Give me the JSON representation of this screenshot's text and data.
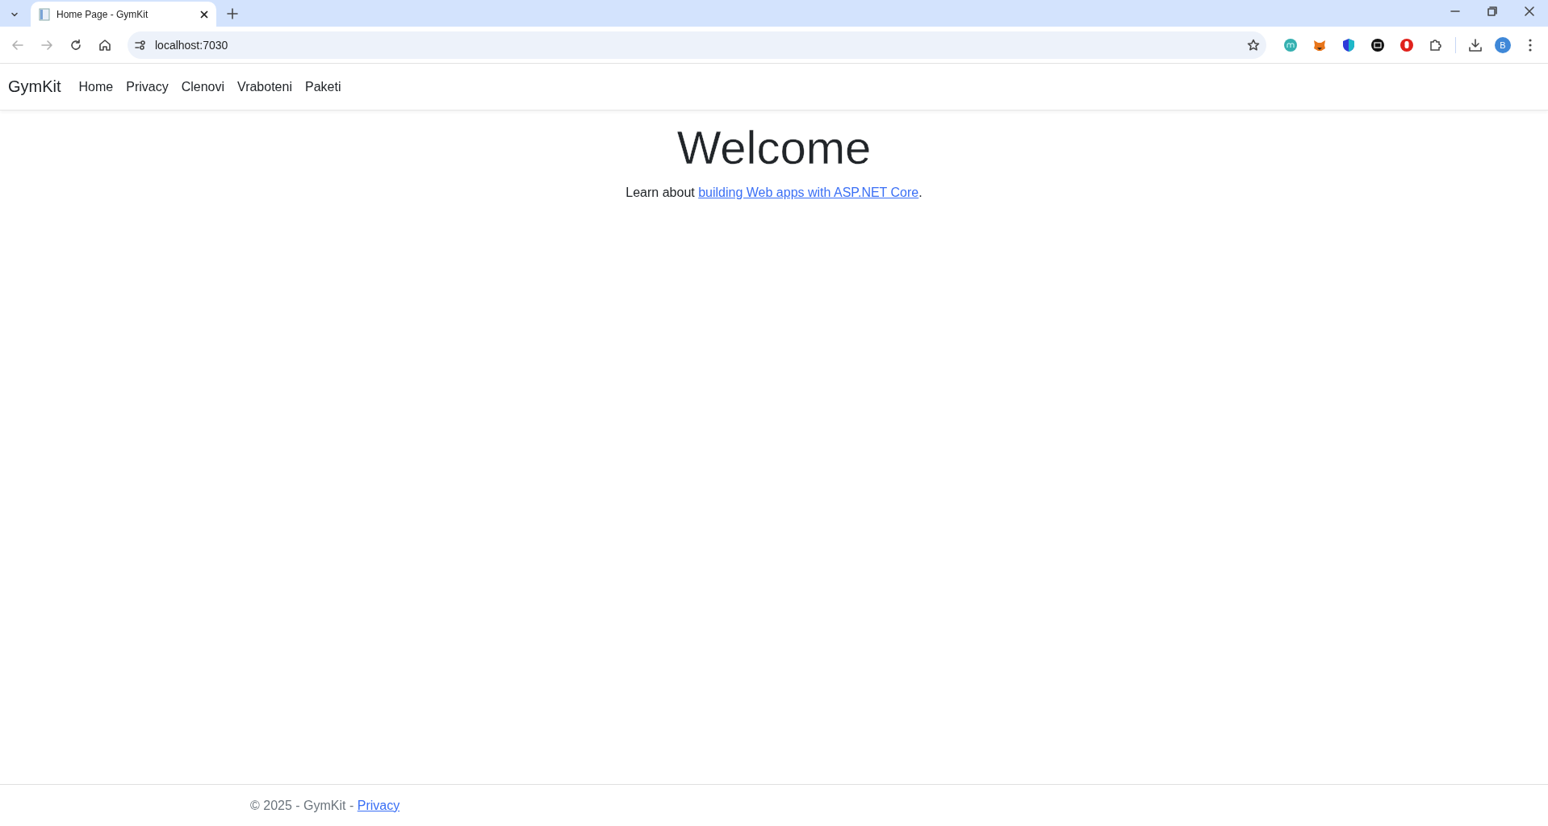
{
  "browser": {
    "tab": {
      "title": "Home Page - GymKit",
      "selected": true
    },
    "address": "localhost:7030",
    "profile_initial": "B"
  },
  "navbar": {
    "brand": "GymKit",
    "links": [
      {
        "label": "Home"
      },
      {
        "label": "Privacy"
      },
      {
        "label": "Clenovi"
      },
      {
        "label": "Vraboteni"
      },
      {
        "label": "Paketi"
      }
    ]
  },
  "main": {
    "heading": "Welcome",
    "intro": {
      "before": "Learn about ",
      "link": "building Web apps with ASP.NET Core",
      "after": "."
    }
  },
  "footer": {
    "text": "© 2025 - GymKit - ",
    "link": "Privacy"
  }
}
